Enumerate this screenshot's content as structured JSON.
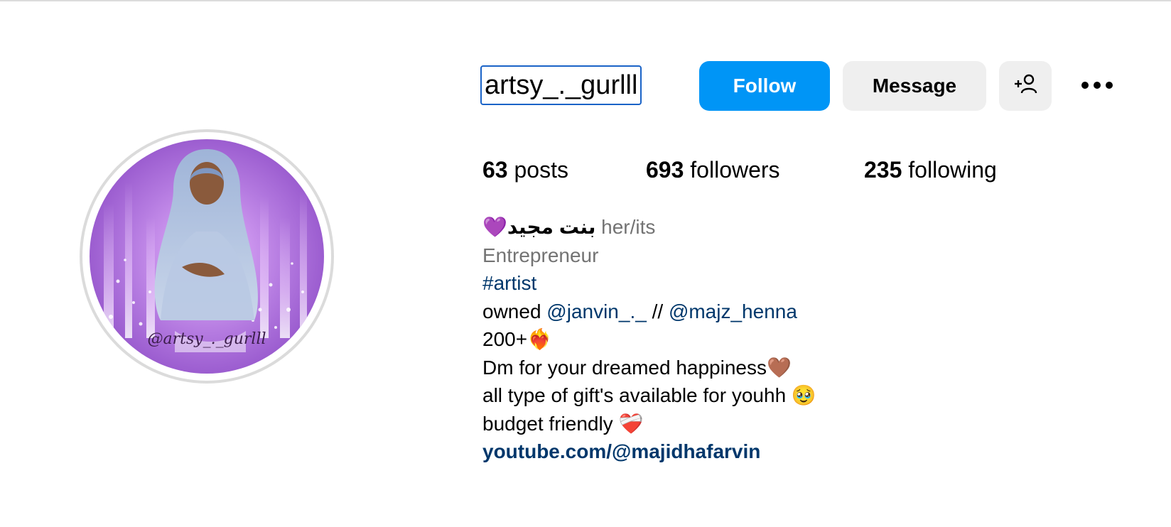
{
  "profile": {
    "username": "artsy_._gurlll",
    "avatar_caption": "@artsy_._gurlll"
  },
  "actions": {
    "follow_label": "Follow",
    "message_label": "Message",
    "add_user_icon": "person-plus-icon",
    "more_icon": "more-horizontal-icon"
  },
  "stats": {
    "posts_count": "63",
    "posts_label": "posts",
    "followers_count": "693",
    "followers_label": "followers",
    "following_count": "235",
    "following_label": "following"
  },
  "bio": {
    "name_arabic": "بنت مجيد",
    "name_emoji": "💜",
    "pronouns": "her/its",
    "category": "Entrepreneur",
    "hashtag": "#artist",
    "owned_prefix": "owned ",
    "owned_link1": "@janvin_._",
    "owned_separator": " // ",
    "owned_link2": "@majz_henna",
    "line_200": "200+❤️‍🔥",
    "line_dm": "Dm for your dreamed happiness🤎",
    "line_gifts": "all type of gift's available for youhh 🥹",
    "line_budget": "budget friendly ❤️‍🩹",
    "website": "youtube.com/@majidhafarvin"
  },
  "colors": {
    "follow_bg": "#0095f6",
    "secondary_bg": "#efefef",
    "link": "#00376b",
    "muted": "#737373",
    "avatar_purple": "#a86ad8"
  }
}
